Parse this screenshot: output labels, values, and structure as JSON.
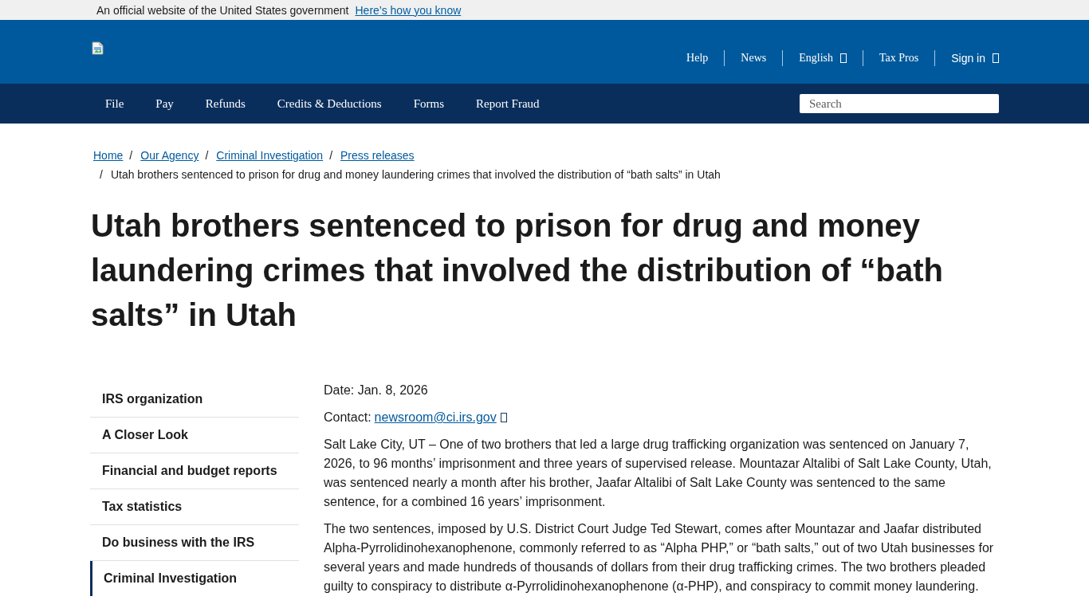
{
  "gov_banner": {
    "text": "An official website of the United States government",
    "link": "Here’s how you know"
  },
  "header": {
    "utility_links": [
      {
        "label": "Help",
        "kind": "link",
        "icon": false
      },
      {
        "label": "News",
        "kind": "link",
        "icon": false
      },
      {
        "label": "English",
        "kind": "link",
        "icon": true
      },
      {
        "label": "Tax Pros",
        "kind": "link",
        "icon": false
      },
      {
        "label": "Sign in",
        "kind": "button",
        "icon": true
      }
    ]
  },
  "main_nav": {
    "items": [
      "File",
      "Pay",
      "Refunds",
      "Credits & Deductions",
      "Forms",
      "Report Fraud"
    ],
    "search": {
      "placeholder": "Search"
    }
  },
  "breadcrumb": [
    {
      "kind": "link",
      "label": "Home"
    },
    {
      "kind": "link",
      "separator": "/",
      "label": "Our Agency"
    },
    {
      "kind": "link",
      "separator": "/",
      "label": "Criminal Investigation"
    },
    {
      "kind": "link",
      "separator": "/",
      "label": "Press releases"
    },
    {
      "kind": "current",
      "separator": "/",
      "label": "Utah brothers sentenced to prison for drug and money laundering crimes that involved the distribution of “bath salts” in Utah"
    }
  ],
  "title": "Utah brothers sentenced to prison for drug and money laundering crimes that involved the distribution of “bath salts” in Utah",
  "sidebar": {
    "items": [
      {
        "label": "IRS organization",
        "selected": false
      },
      {
        "label": "A Closer Look",
        "selected": false
      },
      {
        "label": "Financial and budget reports",
        "selected": false
      },
      {
        "label": "Tax statistics",
        "selected": false
      },
      {
        "label": "Do business with the IRS",
        "selected": false
      },
      {
        "label": "Criminal Investigation",
        "selected": true
      }
    ]
  },
  "article": {
    "date": "Date: Jan. 8, 2026",
    "contact": {
      "label": "Contact:",
      "email": "newsroom@ci.irs.gov",
      "icon": true
    },
    "paragraphs": [
      "Salt Lake City, UT – One of two brothers that led a large drug trafficking organization was sentenced on January 7, 2026, to 96 months’ imprisonment and three years of supervised release. Mountazar Altalibi of Salt Lake County, Utah, was sentenced nearly a month after his brother, Jaafar Altalibi of Salt Lake County was sentenced to the same sentence, for a combined 16 years’ imprisonment.",
      "The two sentences, imposed by U.S. District Court Judge Ted Stewart, comes after Mountazar and Jaafar distributed Alpha-Pyrrolidinohexanophenone, commonly referred to as “Alpha PHP,” or “bath salts,” out of two Utah businesses for several years and made hundreds of thousands of dollars from their drug trafficking crimes. The two brothers pleaded guilty to conspiracy to distribute α-Pyrrolidinohexanophenone (α-PHP), and conspiracy to commit money laundering."
    ]
  }
}
